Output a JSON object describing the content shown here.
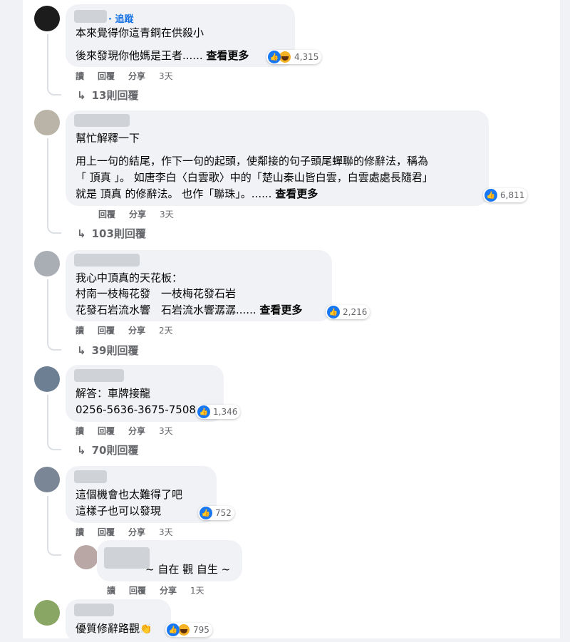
{
  "comments": [
    {
      "follow_label": "· 追蹤",
      "lines": [
        "本來覺得你這青銅在供殺小",
        "後來發現你他媽是王者......"
      ],
      "see_more": "查看更多",
      "reactions": {
        "count": "4,315",
        "icons": [
          "like-icon",
          "haha-icon"
        ]
      },
      "actions": {
        "read": "讀",
        "reply": "回覆",
        "share": "分享",
        "time": "3天"
      },
      "replies": "13則回覆"
    },
    {
      "lines": [
        "幫忙解釋一下",
        "用上一句的結尾，作下一句的起頭，使鄰接的句子頭尾蟬聯的修辭法，稱為",
        "「 頂真 」。 如唐李白〈白雲歌〉中的「楚山秦山皆白雲，白雲處處長隨君」",
        "就是 頂真 的修辭法。 也作「聯珠」。......"
      ],
      "see_more": "查看更多",
      "reactions": {
        "count": "6,811",
        "icons": [
          "like-icon"
        ]
      },
      "actions": {
        "reply": "回覆",
        "share": "分享",
        "time": "3天"
      },
      "replies": "103則回覆"
    },
    {
      "lines": [
        "我心中頂真的天花板：",
        "村南一枝梅花發　一枝梅花發石岩",
        "花發石岩流水響　石岩流水響潺潺......"
      ],
      "see_more": "查看更多",
      "reactions": {
        "count": "2,216",
        "icons": [
          "like-icon"
        ]
      },
      "actions": {
        "read": "讀",
        "reply": "回覆",
        "share": "分享",
        "time": "2天"
      },
      "replies": "39則回覆"
    },
    {
      "lines": [
        "解答：車牌接龍",
        "0256-5636-3675-7508"
      ],
      "reactions": {
        "count": "1,346",
        "icons": [
          "like-icon"
        ]
      },
      "actions": {
        "read": "讀",
        "reply": "回覆",
        "share": "分享",
        "time": "3天"
      },
      "replies": "70則回覆"
    },
    {
      "lines": [
        "這個機會也太難得了吧",
        "這樣子也可以發現"
      ],
      "reactions": {
        "count": "752",
        "icons": [
          "like-icon"
        ]
      },
      "actions": {
        "read": "讀",
        "reply": "回覆",
        "share": "分享",
        "time": "3天"
      },
      "reply": {
        "text": "~ 自在 觀 自生 ~",
        "actions": {
          "read": "讀",
          "reply": "回覆",
          "share": "分享",
          "time": "1天"
        }
      }
    },
    {
      "lines": [
        "優質修辭路觀"
      ],
      "emoji": "👏",
      "reactions": {
        "count": "795",
        "icons": [
          "like-icon",
          "haha-icon"
        ]
      }
    }
  ]
}
